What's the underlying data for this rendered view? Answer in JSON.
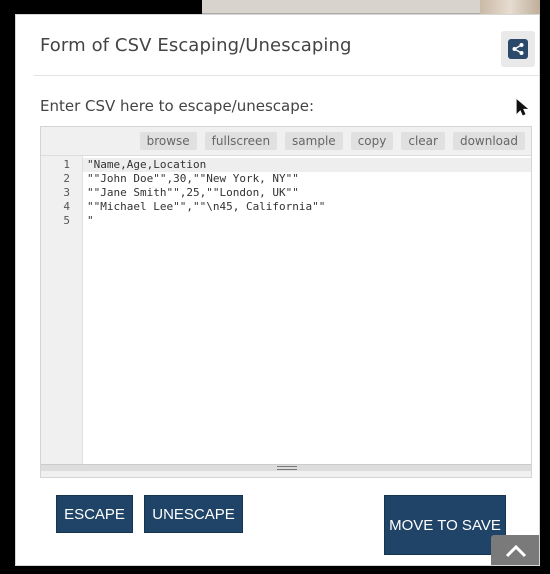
{
  "page": {
    "title": "Form of CSV Escaping/Unescaping"
  },
  "prompt": "Enter CSV here to escape/unescape:",
  "toolbar": {
    "buttons": [
      {
        "label": "browse"
      },
      {
        "label": "fullscreen"
      },
      {
        "label": "sample"
      },
      {
        "label": "copy"
      },
      {
        "label": "clear"
      },
      {
        "label": "download"
      }
    ]
  },
  "editor": {
    "line_numbers": [
      "1",
      "2",
      "3",
      "4",
      "5"
    ],
    "lines": [
      "\"Name,Age,Location",
      "\"\"John Doe\"\",30,\"\"New York, NY\"\"",
      "\"\"Jane Smith\"\",25,\"\"London, UK\"\"",
      "\"\"Michael Lee\"\",\"\"\\n45, California\"\"",
      "\""
    ]
  },
  "actions": {
    "escape_label": "ESCAPE",
    "unescape_label": "UNESCAPE",
    "move_label": "MOVE TO SAVE"
  },
  "icons": {
    "share": "share-icon",
    "scroll_top": "chevron-up-icon",
    "mouse_cursor": "cursor-icon"
  },
  "colors": {
    "primary": "#1f4467",
    "share_bg": "#2b4a6b"
  }
}
